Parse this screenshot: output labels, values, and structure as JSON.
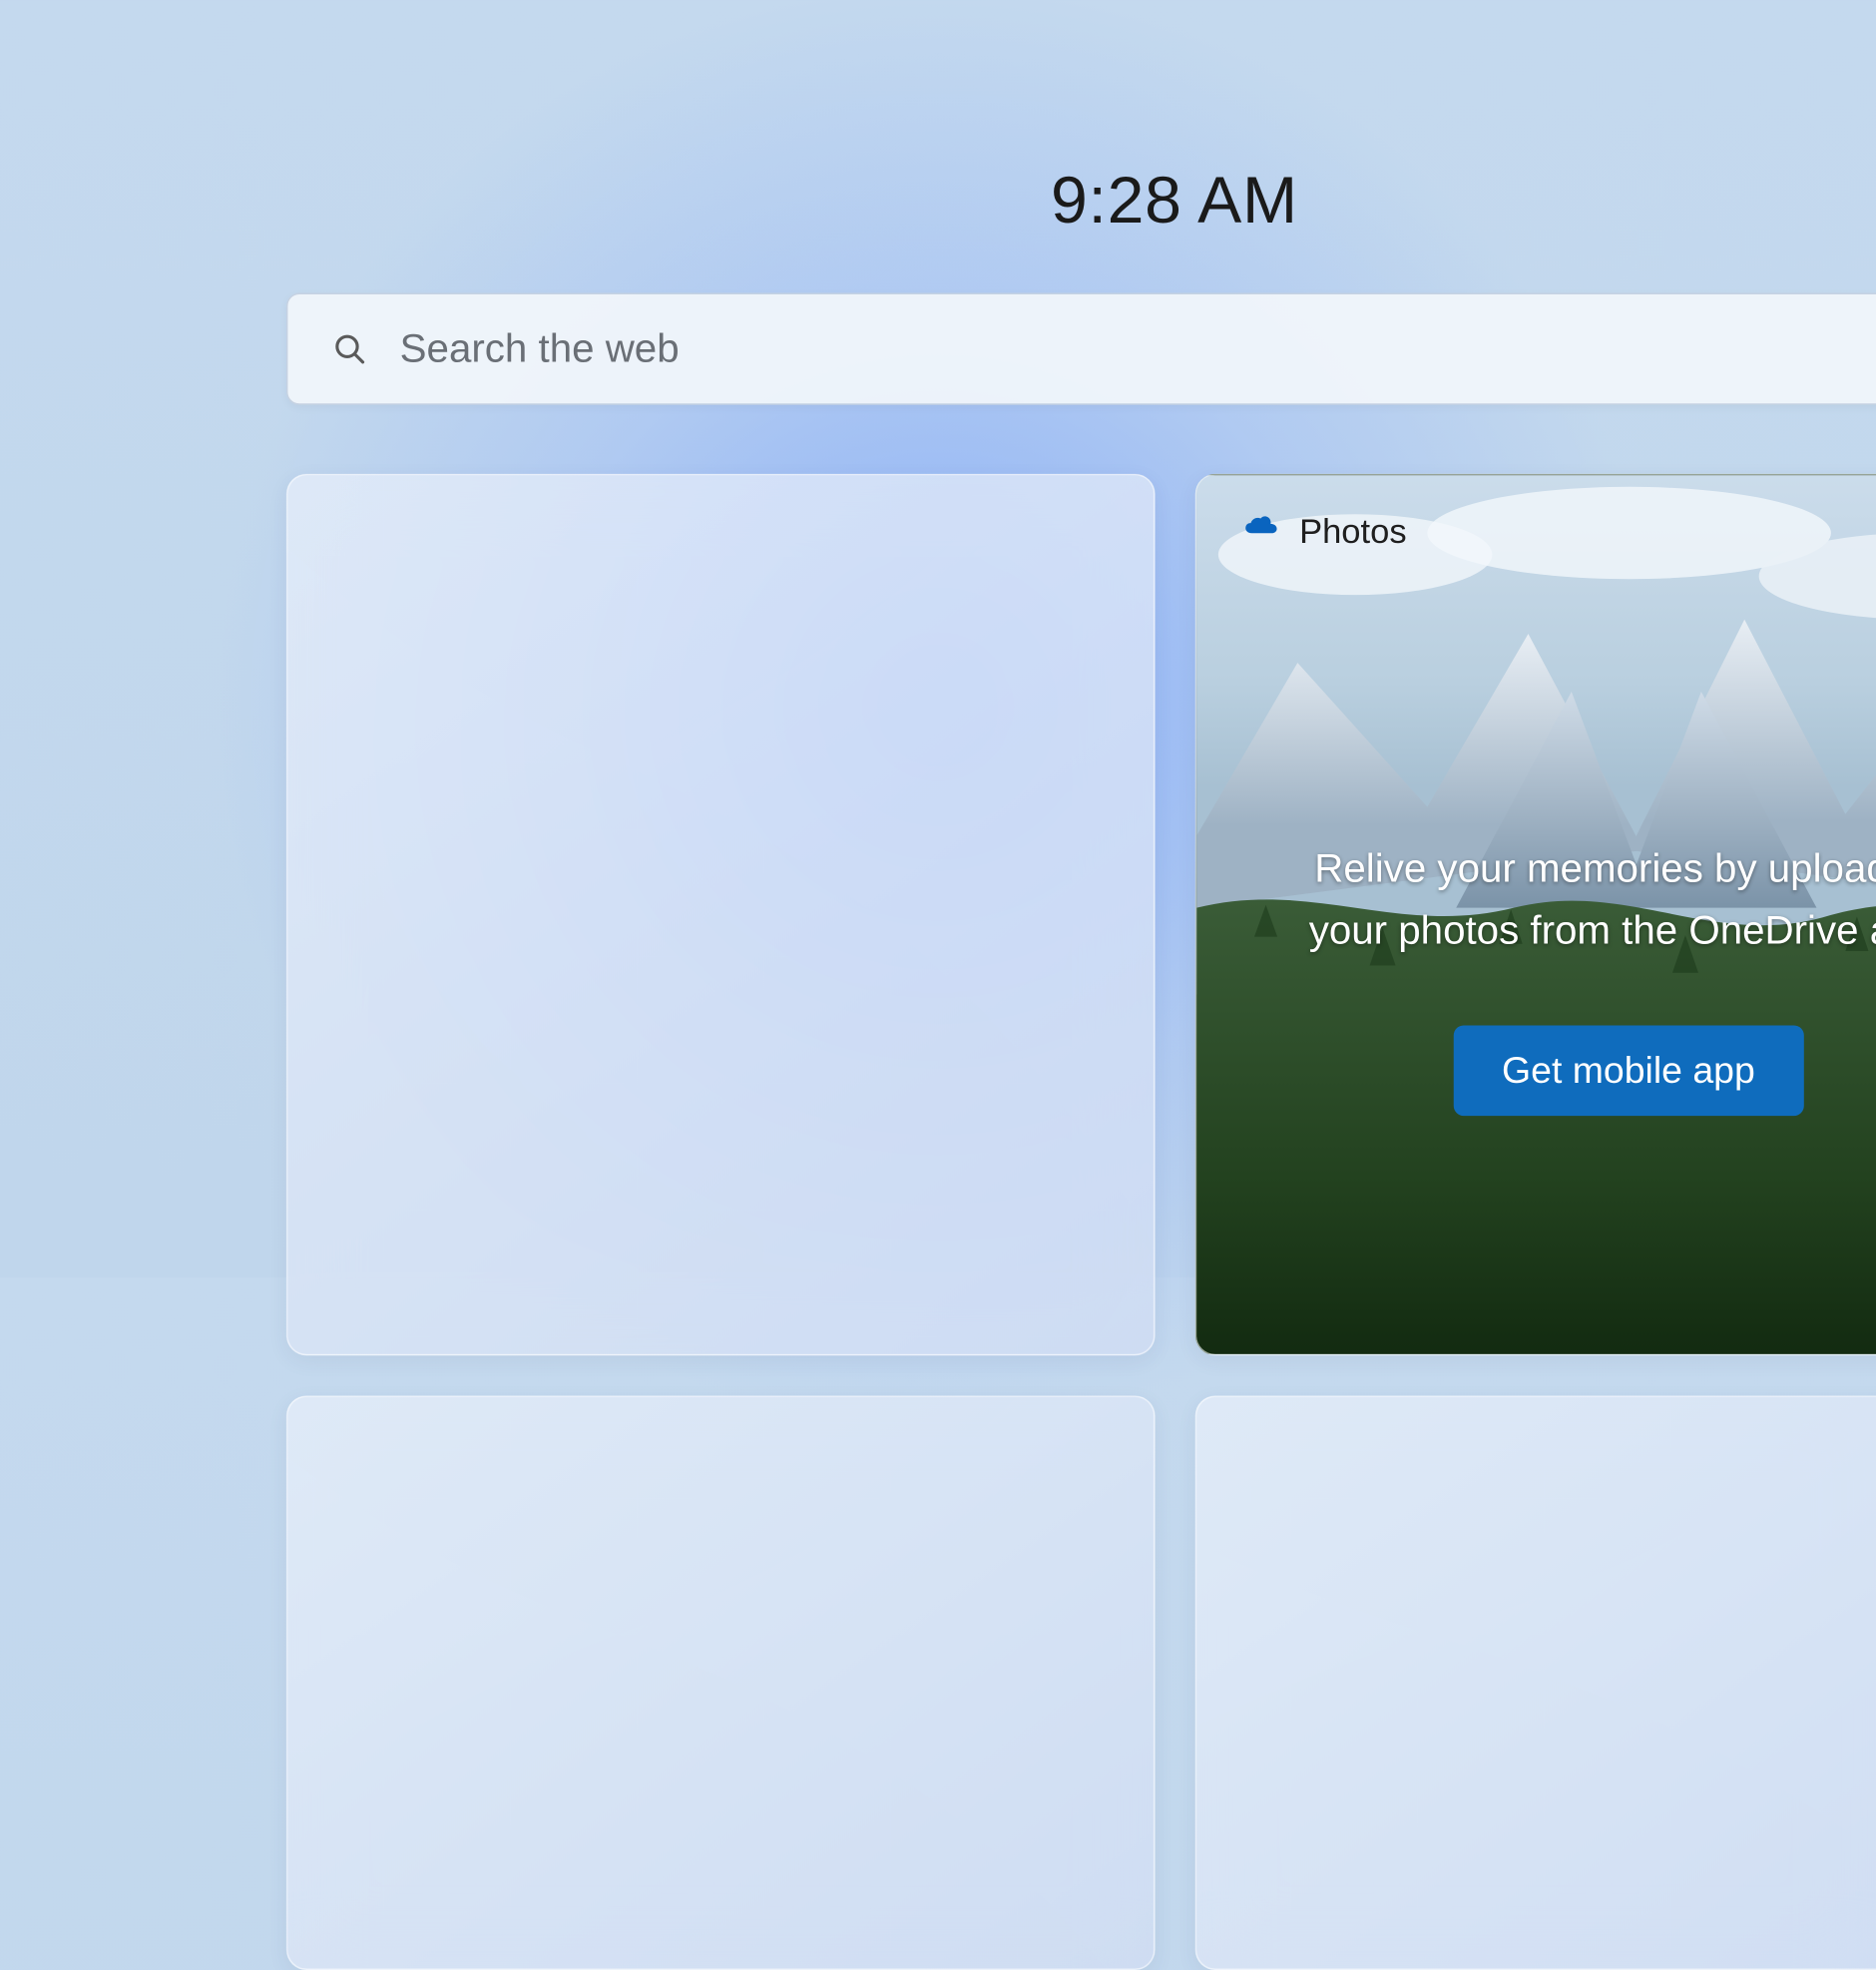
{
  "clock": {
    "time": "9:28 AM"
  },
  "search": {
    "placeholder": "Search the web"
  },
  "photos_widget": {
    "title": "Photos",
    "message": "Relive your memories by uploading your photos from the OneDrive app.",
    "cta_label": "Get mobile app"
  }
}
